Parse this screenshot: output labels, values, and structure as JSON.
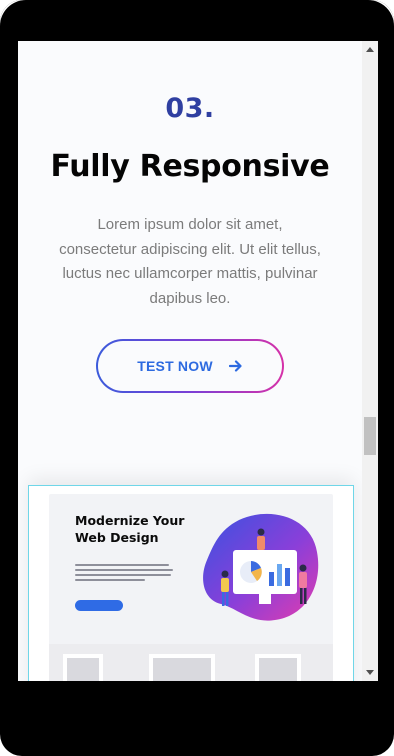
{
  "feature": {
    "step_number": "03.",
    "title": "Fully Responsive",
    "description": "Lorem ipsum dolor sit amet, consectetur adipiscing elit. Ut elit tellus, luctus nec ullamcorper mattis, pulvinar dapibus leo.",
    "button_label": "TEST NOW",
    "button_icon": "arrow-right-icon"
  },
  "preview": {
    "title": "Modernize Your Web Design"
  },
  "scrollbar": {
    "position": 0.58
  },
  "colors": {
    "accent_blue": "#2d6ae0",
    "number_blue": "#2f3fa1",
    "gradient_start": "#3b5bdb",
    "gradient_end": "#d631a8",
    "preview_border": "#6fd6e8"
  }
}
